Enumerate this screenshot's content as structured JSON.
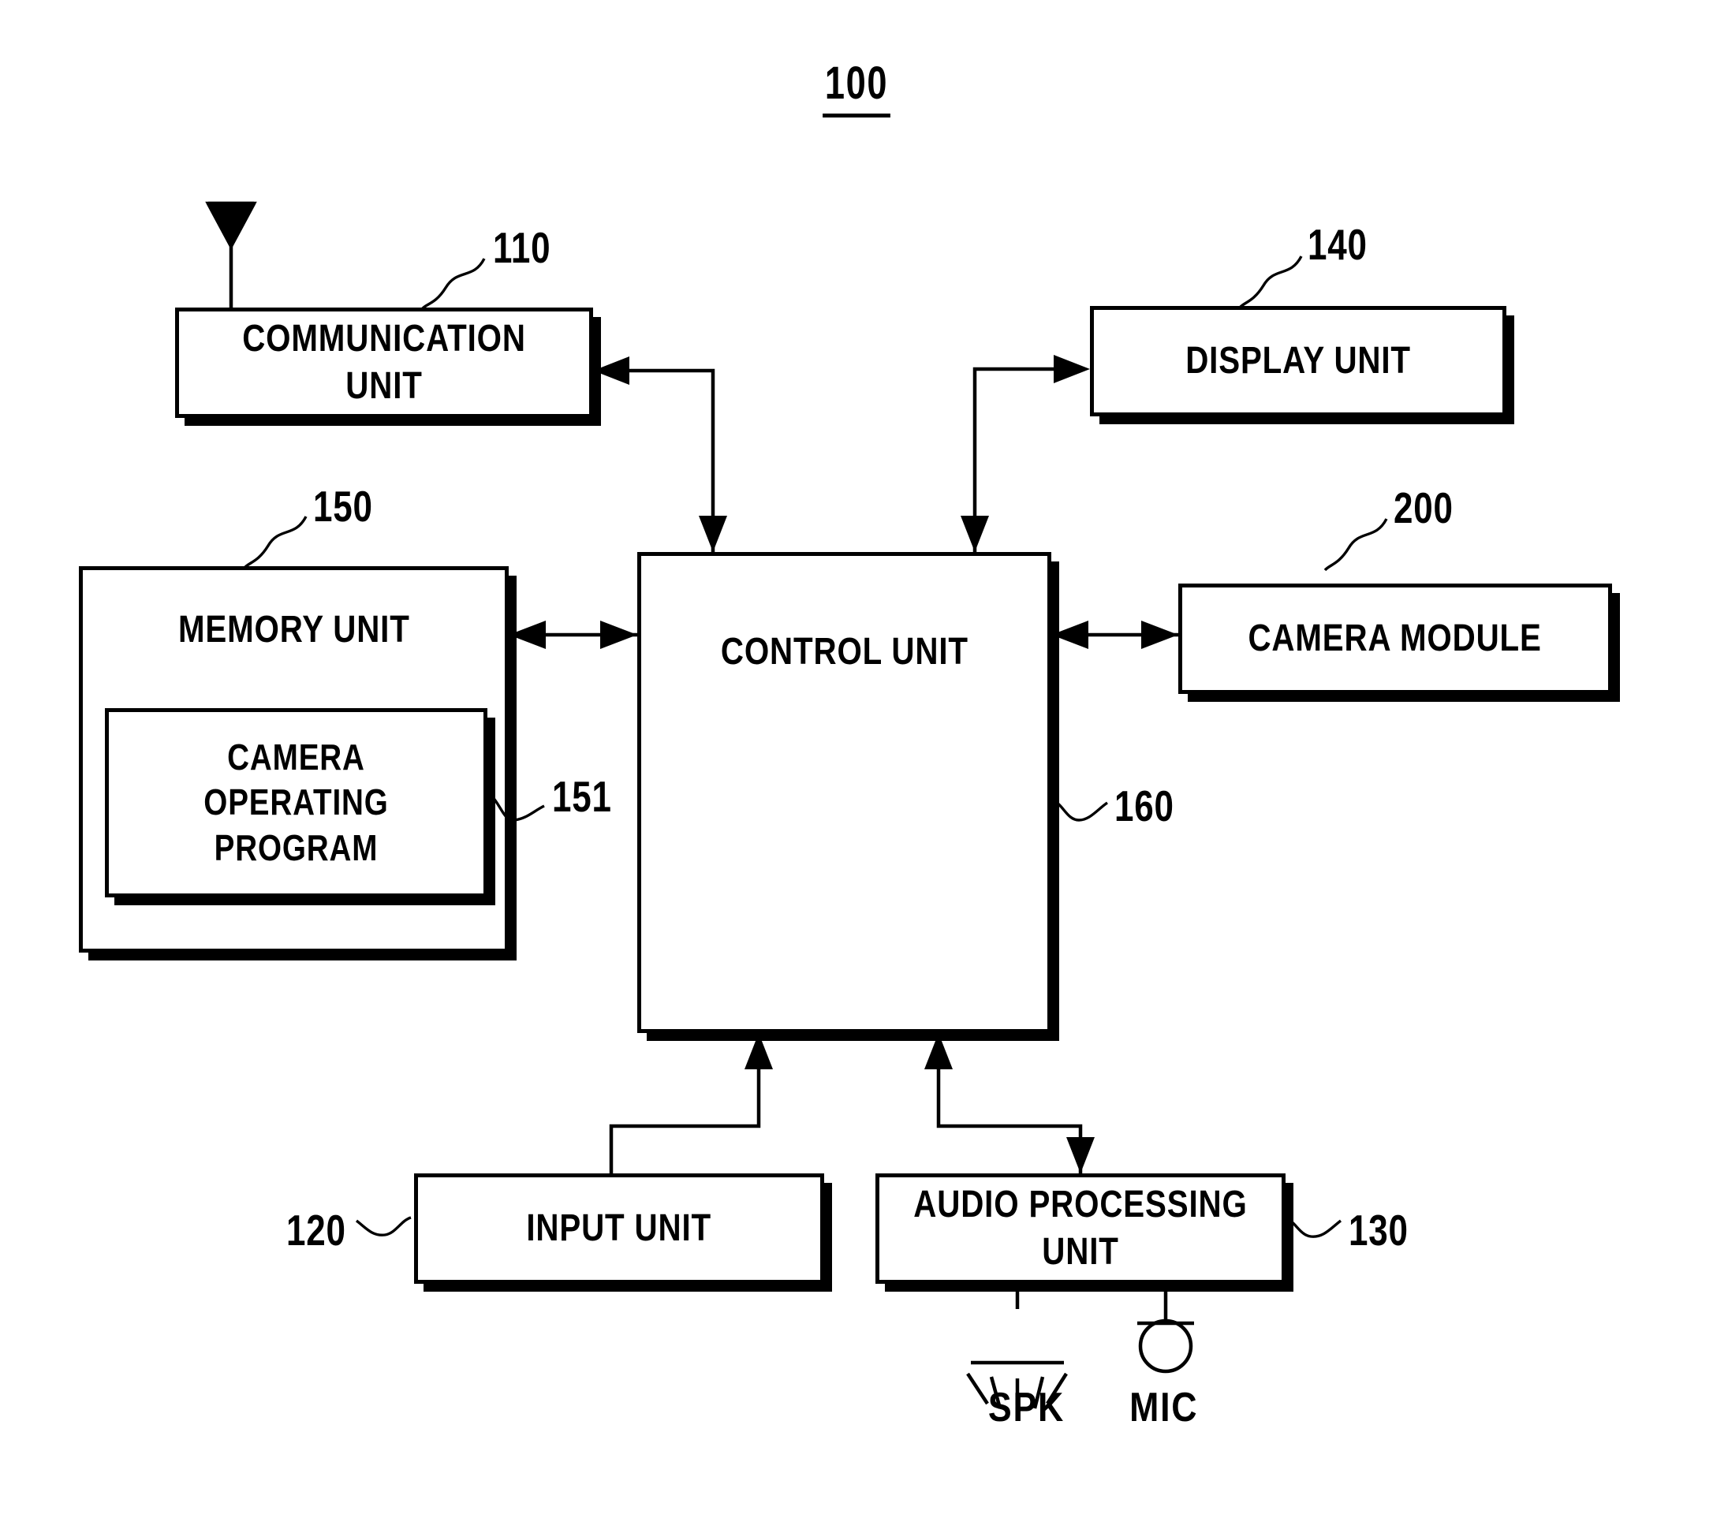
{
  "figure": {
    "number": "100",
    "type": "block-diagram",
    "description": "Mobile terminal block diagram with camera module"
  },
  "blocks": [
    {
      "id": "communication_unit",
      "label": "COMMUNICATION UNIT",
      "ref": "110"
    },
    {
      "id": "display_unit",
      "label": "DISPLAY UNIT",
      "ref": "140"
    },
    {
      "id": "memory_unit",
      "label": "MEMORY UNIT",
      "ref": "150"
    },
    {
      "id": "camera_operating_program",
      "label": "CAMERA OPERATING\nPROGRAM",
      "ref": "151"
    },
    {
      "id": "control_unit",
      "label": "CONTROL UNIT",
      "ref": "160"
    },
    {
      "id": "camera_module",
      "label": "CAMERA MODULE",
      "ref": "200"
    },
    {
      "id": "input_unit",
      "label": "INPUT UNIT",
      "ref": "120"
    },
    {
      "id": "audio_processing_unit",
      "label": "AUDIO PROCESSING UNIT",
      "ref": "130"
    }
  ],
  "refs": {
    "communication_unit": "110",
    "input_unit": "120",
    "audio_processing_unit": "130",
    "display_unit": "140",
    "memory_unit": "150",
    "camera_operating_program": "151",
    "control_unit": "160",
    "camera_module": "200"
  },
  "peripherals": [
    {
      "id": "speaker",
      "label": "SPK",
      "icon": "speaker-icon"
    },
    {
      "id": "microphone",
      "label": "MIC",
      "icon": "microphone-icon"
    }
  ],
  "icons": {
    "antenna": "antenna-icon",
    "speaker": "speaker-icon",
    "microphone": "microphone-icon"
  },
  "connections": [
    {
      "from": "control_unit",
      "to": "communication_unit",
      "direction": "one-way"
    },
    {
      "from": "control_unit",
      "to": "display_unit",
      "direction": "one-way"
    },
    {
      "from": "control_unit",
      "to": "memory_unit",
      "direction": "bidirectional"
    },
    {
      "from": "control_unit",
      "to": "camera_module",
      "direction": "bidirectional"
    },
    {
      "from": "input_unit",
      "to": "control_unit",
      "direction": "one-way"
    },
    {
      "from": "control_unit",
      "to": "audio_processing_unit",
      "direction": "bidirectional"
    }
  ],
  "colors": {
    "stroke": "#000000",
    "background": "#ffffff"
  }
}
